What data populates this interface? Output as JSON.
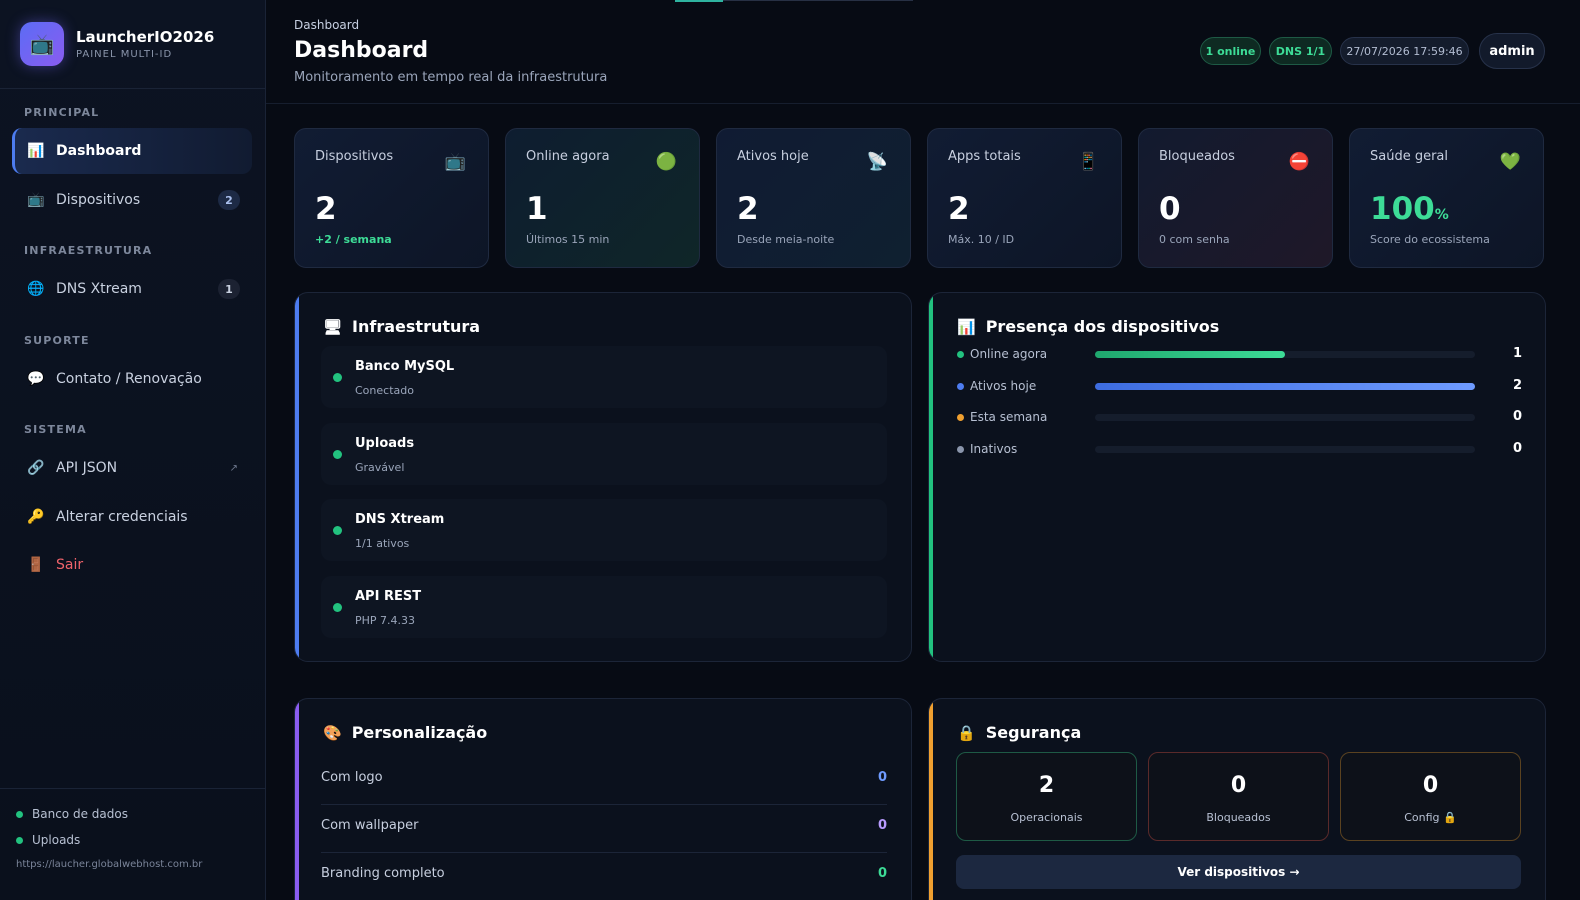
{
  "brand": {
    "icon": "tv-icon",
    "title": "LauncherIO2026",
    "subtitle": "PAINEL MULTI-ID"
  },
  "sidebar": {
    "sections": [
      "PRINCIPAL",
      "INFRAESTRUTURA",
      "SUPORTE",
      "SISTEMA"
    ],
    "items": [
      {
        "label": "Dashboard",
        "icon": "chart-icon",
        "glyph": "📊",
        "active": true
      },
      {
        "label": "Dispositivos",
        "icon": "tv-icon",
        "glyph": "📺",
        "badge": "2"
      },
      {
        "label": "DNS Xtream",
        "icon": "globe-icon",
        "glyph": "🌐",
        "badge": "1"
      },
      {
        "label": "Contato / Renovação",
        "icon": "chat-icon",
        "glyph": "💬"
      },
      {
        "label": "API JSON",
        "icon": "link-icon",
        "glyph": "🔗",
        "external": "↗"
      },
      {
        "label": "Alterar credenciais",
        "icon": "key-icon",
        "glyph": "🔑"
      },
      {
        "label": "Sair",
        "icon": "door-icon",
        "glyph": "🚪"
      }
    ],
    "footer": {
      "status": [
        "Banco de dados",
        "Uploads"
      ],
      "url": "https://laucher.globalwebhost.com.br"
    }
  },
  "header": {
    "breadcrumb": "Dashboard",
    "title": "Dashboard",
    "subtitle": "Monitoramento em tempo real da infraestrutura",
    "pills": {
      "online": "1 online",
      "dns": "DNS 1/1",
      "datetime": "27/07/2026 17:59:46",
      "user": "admin"
    }
  },
  "stats": [
    {
      "label": "Dispositivos",
      "glyph": "📺",
      "value": "2",
      "sub": "+2 / semana"
    },
    {
      "label": "Online agora",
      "glyph": "🟢",
      "value": "1",
      "sub": "Últimos 15 min"
    },
    {
      "label": "Ativos hoje",
      "glyph": "📡",
      "value": "2",
      "sub": "Desde meia-noite"
    },
    {
      "label": "Apps totais",
      "glyph": "📱",
      "value": "2",
      "sub": "Máx. 10 / ID"
    },
    {
      "label": "Bloqueados",
      "glyph": "⛔",
      "value": "0",
      "sub": "0 com senha"
    },
    {
      "label": "Saúde geral",
      "glyph": "💚",
      "value": "100",
      "unit": "%",
      "sub": "Score do ecossistema"
    }
  ],
  "infra": {
    "title": "Infraestrutura",
    "glyph": "🖥",
    "rows": [
      {
        "name": "Banco MySQL",
        "status": "Conectado"
      },
      {
        "name": "Uploads",
        "status": "Gravável"
      },
      {
        "name": "DNS Xtream",
        "status": "1/1 ativos"
      },
      {
        "name": "API REST",
        "status": "PHP 7.4.33"
      }
    ]
  },
  "presence": {
    "title": "Presença dos dispositivos",
    "glyph": "📊",
    "max": 2,
    "rows": [
      {
        "label": "Online agora",
        "value": 1,
        "color": "#22c27f"
      },
      {
        "label": "Ativos hoje",
        "value": 2,
        "color": "#4d7cf0"
      },
      {
        "label": "Esta semana",
        "value": 0,
        "color": "#f0a030"
      },
      {
        "label": "Inativos",
        "value": 0,
        "color": "#8a95ab"
      }
    ]
  },
  "personalization": {
    "title": "Personalização",
    "glyph": "🎨",
    "rows": [
      {
        "label": "Com logo",
        "value": "0",
        "color": "#6f9bff"
      },
      {
        "label": "Com wallpaper",
        "value": "0",
        "color": "#b99cff"
      },
      {
        "label": "Branding completo",
        "value": "0",
        "color": "#3ddc97"
      }
    ]
  },
  "security": {
    "title": "Segurança",
    "glyph": "🔒",
    "boxes": [
      {
        "value": "2",
        "label": "Operacionais",
        "border": "#1e5a45"
      },
      {
        "value": "0",
        "label": "Bloqueados",
        "border": "#5a2a2a"
      },
      {
        "value": "0",
        "label": "Config 🔒",
        "border": "#5a4220"
      }
    ],
    "button": "Ver dispositivos →"
  }
}
